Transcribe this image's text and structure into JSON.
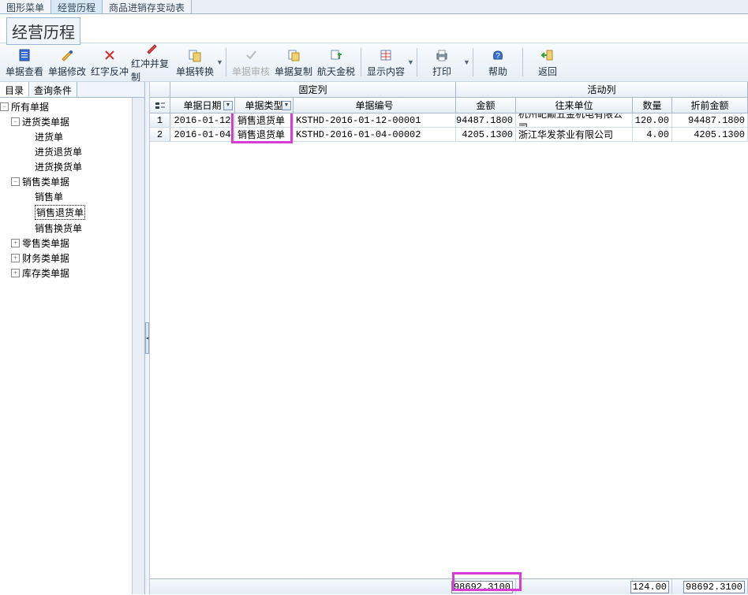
{
  "top_tabs": {
    "t1": "图形菜单",
    "t2": "经营历程",
    "t3": "商品进销存变动表"
  },
  "title": "经营历程",
  "toolbar": {
    "view": "单据查看",
    "edit": "单据修改",
    "red": "红字反冲",
    "redcopy": "红冲并复制",
    "convert": "单据转换",
    "audit": "单据审核",
    "copy": "单据复制",
    "tax": "航天金税",
    "display": "显示内容",
    "print": "打印",
    "help": "帮助",
    "back": "返回"
  },
  "left_tabs": {
    "dir": "目录",
    "query": "查询条件"
  },
  "tree": {
    "all": "所有单据",
    "purchase": "进货类单据",
    "p1": "进货单",
    "p2": "进货退货单",
    "p3": "进货换货单",
    "sales": "销售类单据",
    "s1": "销售单",
    "s2": "销售退货单",
    "s3": "销售换货单",
    "retail": "零售类单据",
    "finance": "财务类单据",
    "stock": "库存类单据"
  },
  "grid": {
    "fixed_label": "固定列",
    "active_label": "活动列",
    "h_date": "单据日期",
    "h_type": "单据类型",
    "h_docno": "单据编号",
    "h_amount": "金额",
    "h_party": "往来单位",
    "h_qty": "数量",
    "h_pre": "折前金额",
    "rows": [
      {
        "n": "1",
        "date": "2016-01-12",
        "type": "销售退货单",
        "doc": "KSTHD-2016-01-12-00001",
        "amt": "94487.1800",
        "party": "杭州屺巅五金机电有限公司",
        "qty": "120.00",
        "pre": "94487.1800"
      },
      {
        "n": "2",
        "date": "2016-01-04",
        "type": "销售退货单",
        "doc": "KSTHD-2016-01-04-00002",
        "amt": "4205.1300",
        "party": "浙江华发茶业有限公司",
        "qty": "4.00",
        "pre": "4205.1300"
      }
    ],
    "totals": {
      "amt": "98692.3100",
      "qty": "124.00",
      "pre": "98692.3100"
    }
  }
}
